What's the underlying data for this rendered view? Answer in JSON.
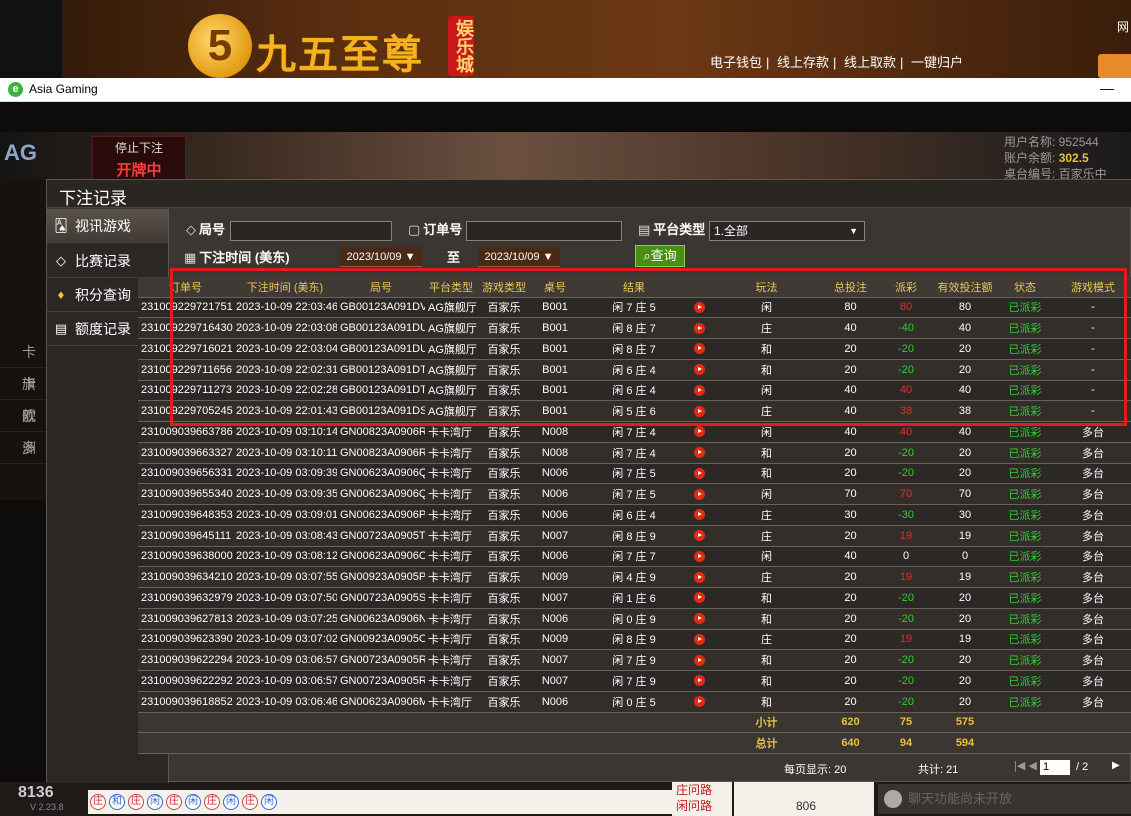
{
  "banner": {
    "logo_number": "5",
    "logo_text": "九五至尊",
    "logo_tag": "娱乐城",
    "nav": [
      "电子钱包",
      "线上存款",
      "线上取款",
      "一键归户"
    ],
    "right_text": "网"
  },
  "window": {
    "title": "Asia Gaming",
    "minimize": "—"
  },
  "game": {
    "ag_logo": "AG",
    "stop_label": "停止下注",
    "status": "开牌中",
    "user_name_label": "用户名称: 952544",
    "balance_label": "账户余额:",
    "balance_value": "302.5",
    "table_label": "桌台编号: 百家乐中",
    "left_items": [
      "卡卡",
      "旗舰",
      "欧洲",
      "多"
    ],
    "bottom_number": "8136",
    "version": "V 2.23.8",
    "road_labels": [
      "庄问路",
      "闲问路"
    ],
    "road_count": "806",
    "chat_placeholder": "聊天功能尚未开放"
  },
  "dialog": {
    "title": "下注记录",
    "sidebar": [
      {
        "label": "视讯游戏",
        "icon": "cards-icon",
        "active": true
      },
      {
        "label": "比赛记录",
        "icon": "ticket-icon",
        "active": false
      },
      {
        "label": "积分查询",
        "icon": "diamond-icon",
        "active": false
      },
      {
        "label": "额度记录",
        "icon": "document-icon",
        "active": false
      }
    ],
    "filters": {
      "round_label": "局号",
      "round_value": "",
      "order_label": "订单号",
      "order_value": "",
      "platform_label": "平台类型",
      "platform_value": "1.全部",
      "time_label": "下注时间 (美东)",
      "date_from": "2023/10/09",
      "to_label": "至",
      "date_to": "2023/10/09",
      "query_label": "查询"
    },
    "columns": [
      "订单号",
      "下注时间 (美东)",
      "局号",
      "平台类型",
      "游戏类型",
      "桌号",
      "结果",
      "",
      "玩法",
      "总投注",
      "派彩",
      "有效投注额",
      "状态",
      "游戏模式"
    ],
    "rows": [
      [
        "231009229721751",
        "2023-10-09 22:03:46",
        "GB00123A091DV",
        "AG旗舰厅",
        "百家乐",
        "B001",
        "闲 7 庄 5",
        "闲",
        "80",
        "80",
        "80",
        "已派彩",
        "-"
      ],
      [
        "231009229716430",
        "2023-10-09 22:03:08",
        "GB00123A091DU",
        "AG旗舰厅",
        "百家乐",
        "B001",
        "闲 8 庄 7",
        "庄",
        "40",
        "-40",
        "40",
        "已派彩",
        "-"
      ],
      [
        "231009229716021",
        "2023-10-09 22:03:04",
        "GB00123A091DU",
        "AG旗舰厅",
        "百家乐",
        "B001",
        "闲 8 庄 7",
        "和",
        "20",
        "-20",
        "20",
        "已派彩",
        "-"
      ],
      [
        "231009229711656",
        "2023-10-09 22:02:31",
        "GB00123A091DT",
        "AG旗舰厅",
        "百家乐",
        "B001",
        "闲 6 庄 4",
        "和",
        "20",
        "-20",
        "20",
        "已派彩",
        "-"
      ],
      [
        "231009229711273",
        "2023-10-09 22:02:28",
        "GB00123A091DT",
        "AG旗舰厅",
        "百家乐",
        "B001",
        "闲 6 庄 4",
        "闲",
        "40",
        "40",
        "40",
        "已派彩",
        "-"
      ],
      [
        "231009229705245",
        "2023-10-09 22:01:43",
        "GB00123A091DS",
        "AG旗舰厅",
        "百家乐",
        "B001",
        "闲 5 庄 6",
        "庄",
        "40",
        "38",
        "38",
        "已派彩",
        "-"
      ],
      [
        "231009039663786",
        "2023-10-09 03:10:14",
        "GN00823A0906R",
        "卡卡湾厅",
        "百家乐",
        "N008",
        "闲 7 庄 4",
        "闲",
        "40",
        "40",
        "40",
        "已派彩",
        "多台"
      ],
      [
        "231009039663327",
        "2023-10-09 03:10:11",
        "GN00823A0906R",
        "卡卡湾厅",
        "百家乐",
        "N008",
        "闲 7 庄 4",
        "和",
        "20",
        "-20",
        "20",
        "已派彩",
        "多台"
      ],
      [
        "231009039656331",
        "2023-10-09 03:09:39",
        "GN00623A0906Q",
        "卡卡湾厅",
        "百家乐",
        "N006",
        "闲 7 庄 5",
        "和",
        "20",
        "-20",
        "20",
        "已派彩",
        "多台"
      ],
      [
        "231009039655340",
        "2023-10-09 03:09:35",
        "GN00623A0906Q",
        "卡卡湾厅",
        "百家乐",
        "N006",
        "闲 7 庄 5",
        "闲",
        "70",
        "70",
        "70",
        "已派彩",
        "多台"
      ],
      [
        "231009039648353",
        "2023-10-09 03:09:01",
        "GN00623A0906P",
        "卡卡湾厅",
        "百家乐",
        "N006",
        "闲 6 庄 4",
        "庄",
        "30",
        "-30",
        "30",
        "已派彩",
        "多台"
      ],
      [
        "231009039645111",
        "2023-10-09 03:08:43",
        "GN00723A0905T",
        "卡卡湾厅",
        "百家乐",
        "N007",
        "闲 8 庄 9",
        "庄",
        "20",
        "19",
        "19",
        "已派彩",
        "多台"
      ],
      [
        "231009039638000",
        "2023-10-09 03:08:12",
        "GN00623A0906O",
        "卡卡湾厅",
        "百家乐",
        "N006",
        "闲 7 庄 7",
        "闲",
        "40",
        "0",
        "0",
        "已派彩",
        "多台"
      ],
      [
        "231009039634210",
        "2023-10-09 03:07:55",
        "GN00923A0905P",
        "卡卡湾厅",
        "百家乐",
        "N009",
        "闲 4 庄 9",
        "庄",
        "20",
        "19",
        "19",
        "已派彩",
        "多台"
      ],
      [
        "231009039632979",
        "2023-10-09 03:07:50",
        "GN00723A0905S",
        "卡卡湾厅",
        "百家乐",
        "N007",
        "闲 1 庄 6",
        "和",
        "20",
        "-20",
        "20",
        "已派彩",
        "多台"
      ],
      [
        "231009039627813",
        "2023-10-09 03:07:25",
        "GN00623A0906N",
        "卡卡湾厅",
        "百家乐",
        "N006",
        "闲 0 庄 9",
        "和",
        "20",
        "-20",
        "20",
        "已派彩",
        "多台"
      ],
      [
        "231009039623390",
        "2023-10-09 03:07:02",
        "GN00923A0905O",
        "卡卡湾厅",
        "百家乐",
        "N009",
        "闲 8 庄 9",
        "庄",
        "20",
        "19",
        "19",
        "已派彩",
        "多台"
      ],
      [
        "231009039622294",
        "2023-10-09 03:06:57",
        "GN00723A0905R",
        "卡卡湾厅",
        "百家乐",
        "N007",
        "闲 7 庄 9",
        "和",
        "20",
        "-20",
        "20",
        "已派彩",
        "多台"
      ],
      [
        "231009039622292",
        "2023-10-09 03:06:57",
        "GN00723A0905R",
        "卡卡湾厅",
        "百家乐",
        "N007",
        "闲 7 庄 9",
        "和",
        "20",
        "-20",
        "20",
        "已派彩",
        "多台"
      ],
      [
        "231009039618852",
        "2023-10-09 03:06:46",
        "GN00623A0906M",
        "卡卡湾厅",
        "百家乐",
        "N006",
        "闲 0 庄 5",
        "和",
        "20",
        "-20",
        "20",
        "已派彩",
        "多台"
      ]
    ],
    "subtotal": {
      "label": "小计",
      "total_bet": "620",
      "payout": "75",
      "valid": "575"
    },
    "total": {
      "label": "总计",
      "total_bet": "640",
      "payout": "94",
      "valid": "594"
    },
    "pager": {
      "per_page": "每页显示: 20",
      "total": "共计: 21",
      "nav_first": "|◀ ◀",
      "page": "1",
      "page_total": "/ 2",
      "next": "▶"
    }
  },
  "colors": {
    "highlight": "#e21a22",
    "positive": "#2fd02f",
    "negative": "#e03030",
    "header_text": "#e8c75a"
  }
}
